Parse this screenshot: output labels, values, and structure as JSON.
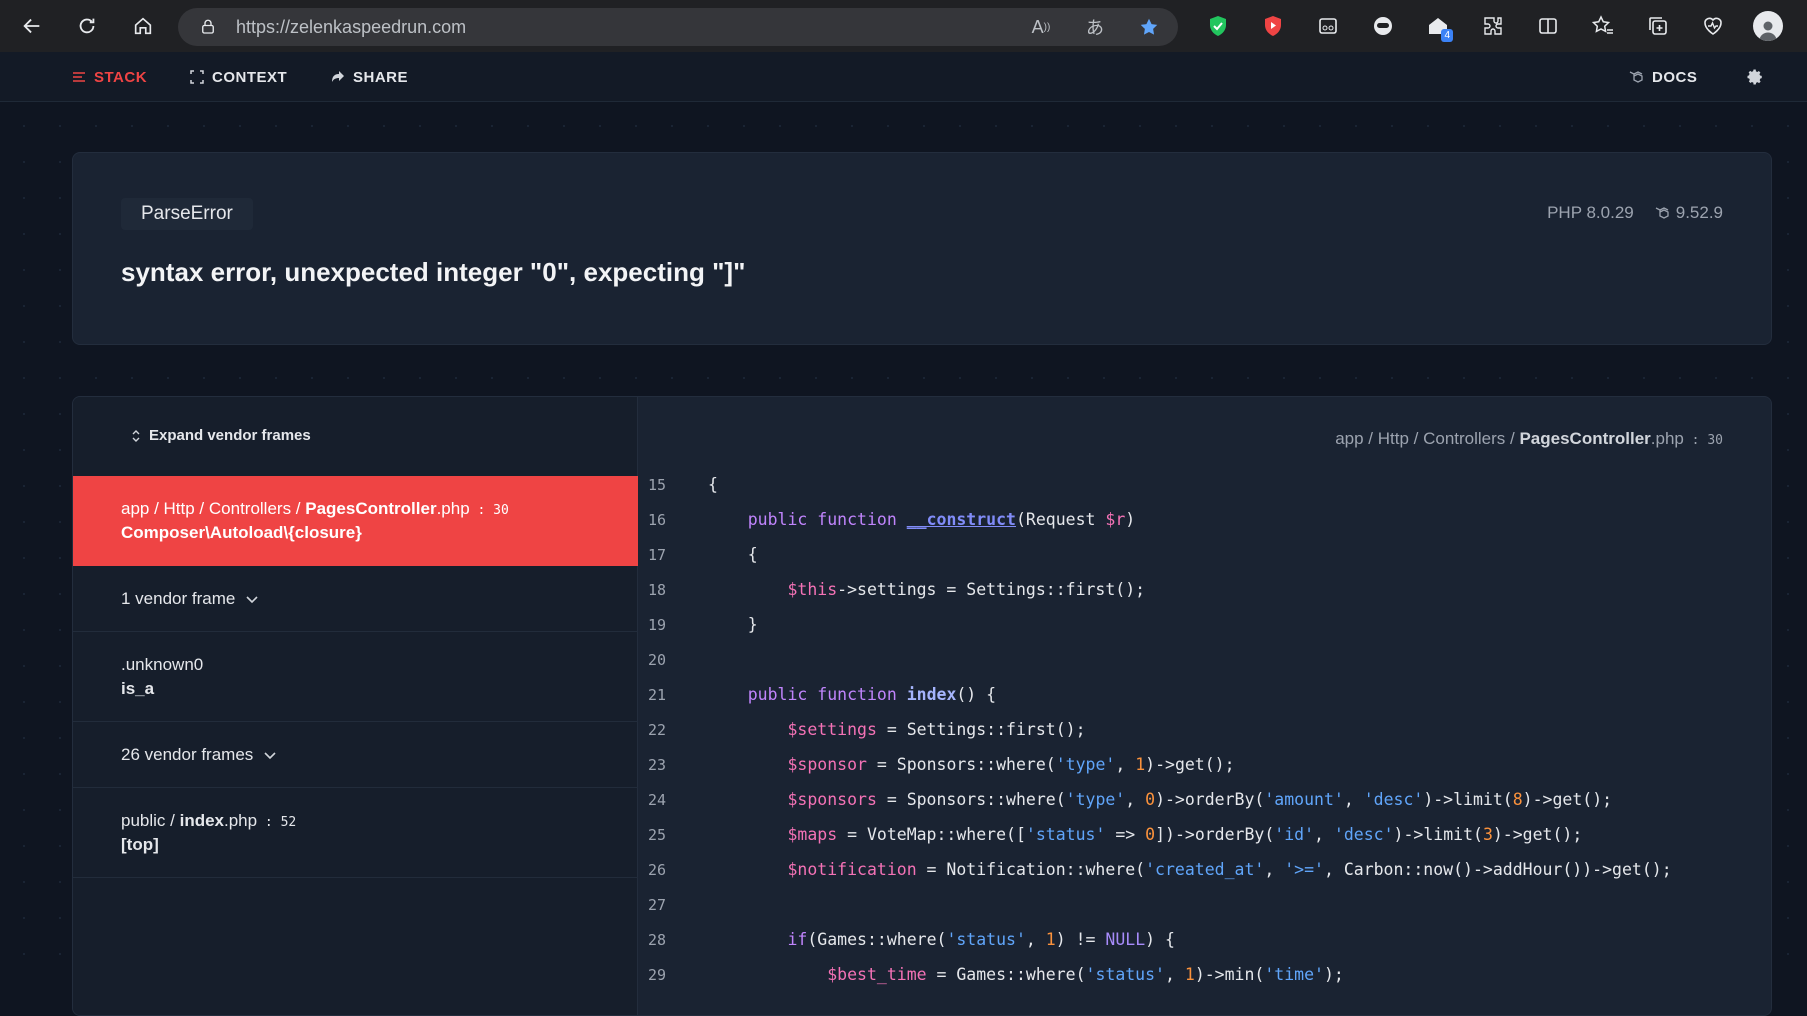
{
  "browser": {
    "url": "https://zelenkaspeedrun.com",
    "extension_badge": "4"
  },
  "app_nav": {
    "stack": "STACK",
    "context": "CONTEXT",
    "share": "SHARE",
    "docs": "DOCS"
  },
  "error": {
    "exception_class": "ParseError",
    "php_version": "PHP 8.0.29",
    "laravel_version": "9.52.9",
    "message": "syntax error, unexpected integer \"0\", expecting \"]\""
  },
  "frames": {
    "expand_vendor_label": "Expand vendor frames",
    "selected": {
      "path_prefix": "app / Http / Controllers / ",
      "file": "PagesController",
      "ext": ".php",
      "line": " : 30",
      "function": "Composer\\Autoload\\{closure}"
    },
    "vendor_1": "1 vendor frame",
    "unknown": {
      "path": ".unknown0",
      "function": "is_a"
    },
    "vendor_26": "26 vendor frames",
    "public": {
      "path_prefix": "public / ",
      "file": "index",
      "ext": ".php",
      "line": " : 52",
      "function": "[top]"
    }
  },
  "code": {
    "file_prefix": "app / Http / Controllers / ",
    "file_name": "PagesController",
    "file_ext": ".php",
    "file_line": " : 30",
    "line_numbers": [
      "15",
      "16",
      "17",
      "18",
      "19",
      "20",
      "21",
      "22",
      "23",
      "24",
      "25",
      "26",
      "27",
      "28",
      "29"
    ]
  },
  "colors": {
    "accent": "#ef4444",
    "background": "#0f1521",
    "card": "#1a2332"
  }
}
